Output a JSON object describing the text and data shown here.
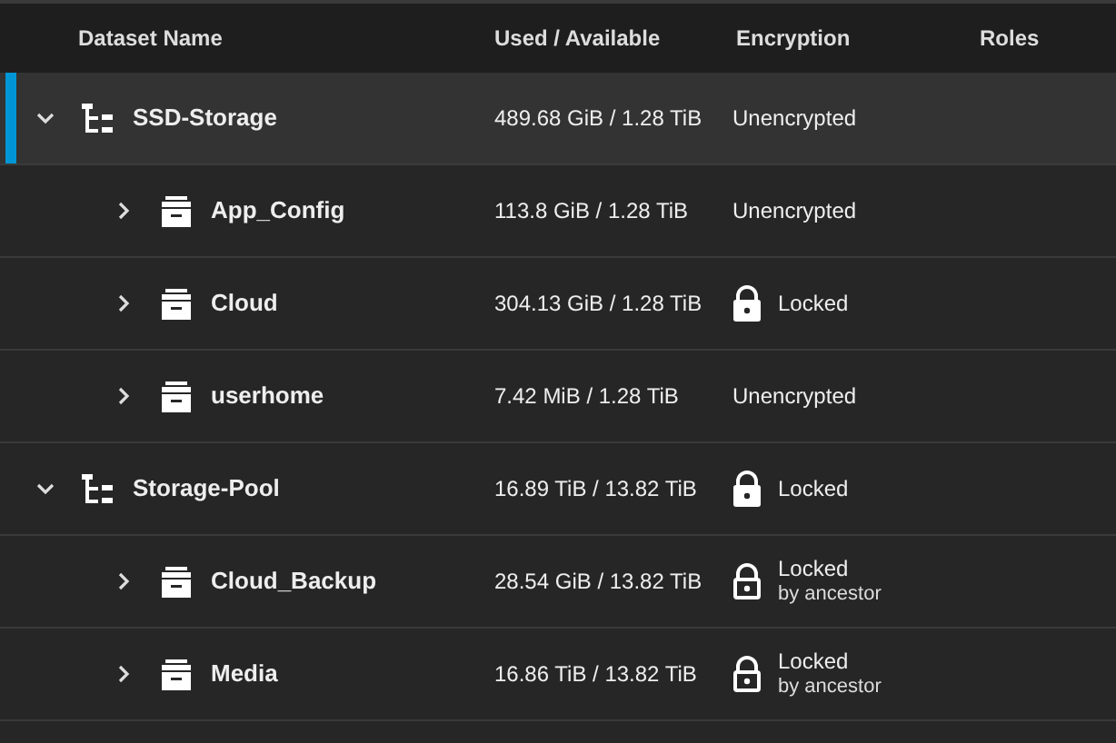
{
  "table": {
    "columns": [
      "Dataset Name",
      "Used / Available",
      "Encryption",
      "Roles"
    ],
    "rows": [
      {
        "kind": "pool",
        "name": "SSD-Storage",
        "usage": "489.68 GiB / 1.28 TiB",
        "encryption": {
          "kind": "plain",
          "label": "Unencrypted"
        },
        "expanded": true,
        "selected": true,
        "children": [
          {
            "kind": "dataset",
            "name": "App_Config",
            "usage": "113.8 GiB / 1.28 TiB",
            "encryption": {
              "kind": "plain",
              "label": "Unencrypted"
            },
            "expanded": false,
            "selected": false
          },
          {
            "kind": "dataset",
            "name": "Cloud",
            "usage": "304.13 GiB / 1.28 TiB",
            "encryption": {
              "kind": "locked",
              "label": "Locked"
            },
            "expanded": false,
            "selected": false
          },
          {
            "kind": "dataset",
            "name": "userhome",
            "usage": "7.42 MiB / 1.28 TiB",
            "encryption": {
              "kind": "plain",
              "label": "Unencrypted"
            },
            "expanded": false,
            "selected": false
          }
        ]
      },
      {
        "kind": "pool",
        "name": "Storage-Pool",
        "usage": "16.89 TiB / 13.82 TiB",
        "encryption": {
          "kind": "locked",
          "label": "Locked"
        },
        "expanded": true,
        "selected": false,
        "children": [
          {
            "kind": "dataset",
            "name": "Cloud_Backup",
            "usage": "28.54 GiB / 13.82 TiB",
            "encryption": {
              "kind": "inherited",
              "label": "Locked",
              "note": "by ancestor"
            },
            "expanded": false,
            "selected": false
          },
          {
            "kind": "dataset",
            "name": "Media",
            "usage": "16.86 TiB / 13.82 TiB",
            "encryption": {
              "kind": "inherited",
              "label": "Locked",
              "note": "by ancestor"
            },
            "expanded": false,
            "selected": false
          }
        ]
      }
    ]
  }
}
